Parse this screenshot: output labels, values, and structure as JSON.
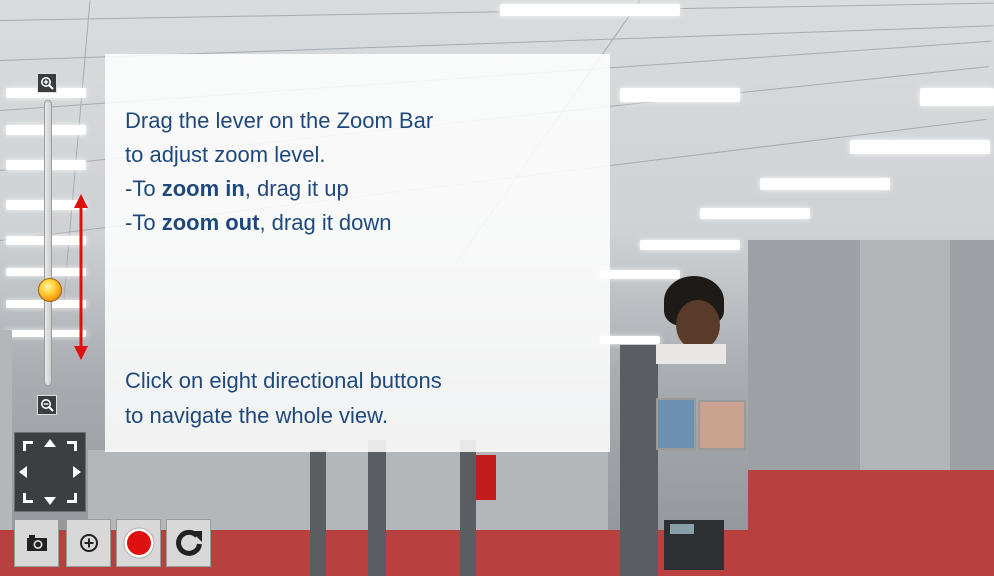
{
  "zoom_bar": {
    "zoom_in_icon": "zoom-in-icon",
    "zoom_out_icon": "zoom-out-icon",
    "lever_level": 0.32
  },
  "instructions": {
    "zoom_line1": "Drag the lever on the Zoom Bar",
    "zoom_line2": "to adjust zoom level.",
    "zoom_in_prefix": "-To ",
    "zoom_in_bold": "zoom in",
    "zoom_in_suffix": ", drag it up",
    "zoom_out_prefix": "-To ",
    "zoom_out_bold": "zoom out",
    "zoom_out_suffix": ", drag it down",
    "nav_line1": "Click on eight directional buttons",
    "nav_line2": "to navigate the whole view."
  },
  "toolbar": {
    "buttons": [
      "camera-snapshot-icon",
      "digital-zoom-icon",
      "record-icon",
      "refresh-icon"
    ]
  },
  "colors": {
    "instruction_text": "#1f497d",
    "arrow": "#e01010",
    "record": "#e01010"
  }
}
